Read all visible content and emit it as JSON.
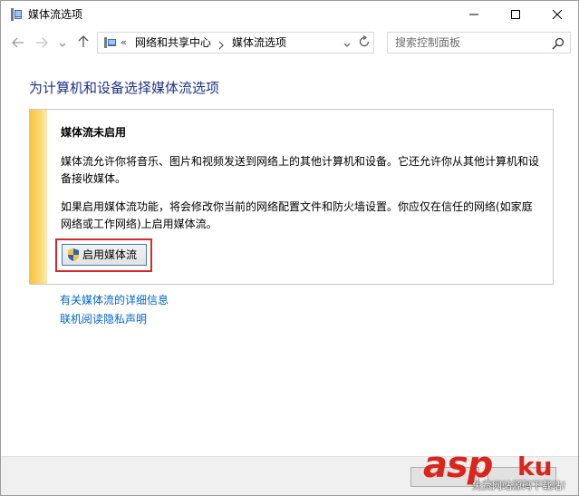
{
  "window": {
    "title": "媒体流选项",
    "minimize_icon": "minimize-icon",
    "maximize_icon": "maximize-icon",
    "close_icon": "close-icon"
  },
  "nav": {
    "back_icon": "arrow-left-icon",
    "forward_icon": "arrow-right-icon",
    "recent_icon": "chevron-down-icon",
    "up_icon": "arrow-up-icon"
  },
  "address": {
    "overflow": "«",
    "breadcrumbs": [
      "网络和共享中心",
      "媒体流选项"
    ],
    "separator_icon": "chevron-right-icon",
    "dropdown_icon": "chevron-down-icon",
    "refresh_icon": "refresh-icon"
  },
  "search": {
    "placeholder": "搜索控制面板",
    "icon": "search-icon"
  },
  "main": {
    "heading": "为计算机和设备选择媒体流选项",
    "panel": {
      "title": "媒体流未启用",
      "paragraph_1": "媒体流允许你将音乐、图片和视频发送到网络上的其他计算机和设备。它还允许你从其他计算机和设备接收媒体。",
      "paragraph_2": "如果启用媒体流功能，将会修改你当前的网络配置文件和防火墙设置。你应仅在信任的网络(如家庭网络或工作网络)上启用媒体流。",
      "enable_button_label": "启用媒体流",
      "enable_button_icon": "uac-shield-icon"
    },
    "links": [
      "有关媒体流的详细信息",
      "联机阅读隐私声明"
    ]
  },
  "watermark": {
    "brand": "asp",
    "brand_suffix": "ku",
    "subtitle": "免费网站源码下载站!"
  },
  "colors": {
    "heading": "#1e3287",
    "link": "#0066cc",
    "stripe": "#f7c33c",
    "highlight": "#d7282a",
    "watermark": "#d9261c"
  }
}
